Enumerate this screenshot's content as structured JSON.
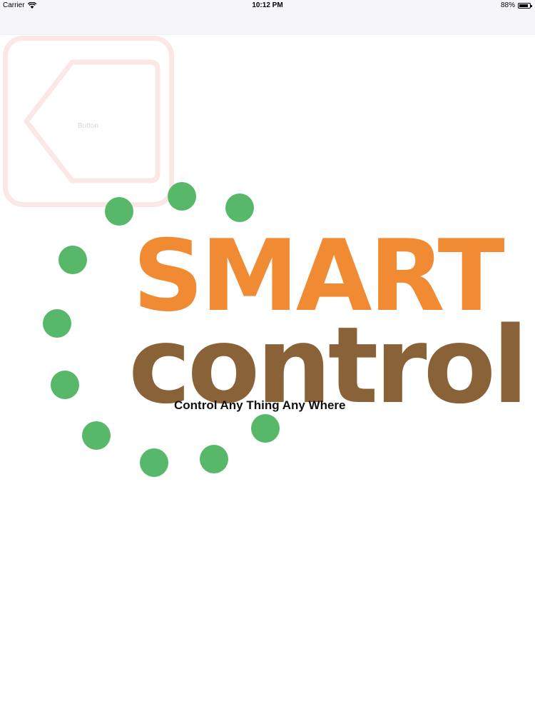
{
  "status_bar": {
    "carrier": "Carrier",
    "time": "10:12 PM",
    "battery_percent_label": "88%",
    "battery_level": 0.88
  },
  "back_button": {
    "label": "Button"
  },
  "logo": {
    "word_top": "SMART",
    "word_bottom": "control",
    "accent_color": "#f08a33",
    "secondary_color": "#8a6238",
    "dot_color": "#56b868"
  },
  "tagline": "Control Any Thing Any Where"
}
